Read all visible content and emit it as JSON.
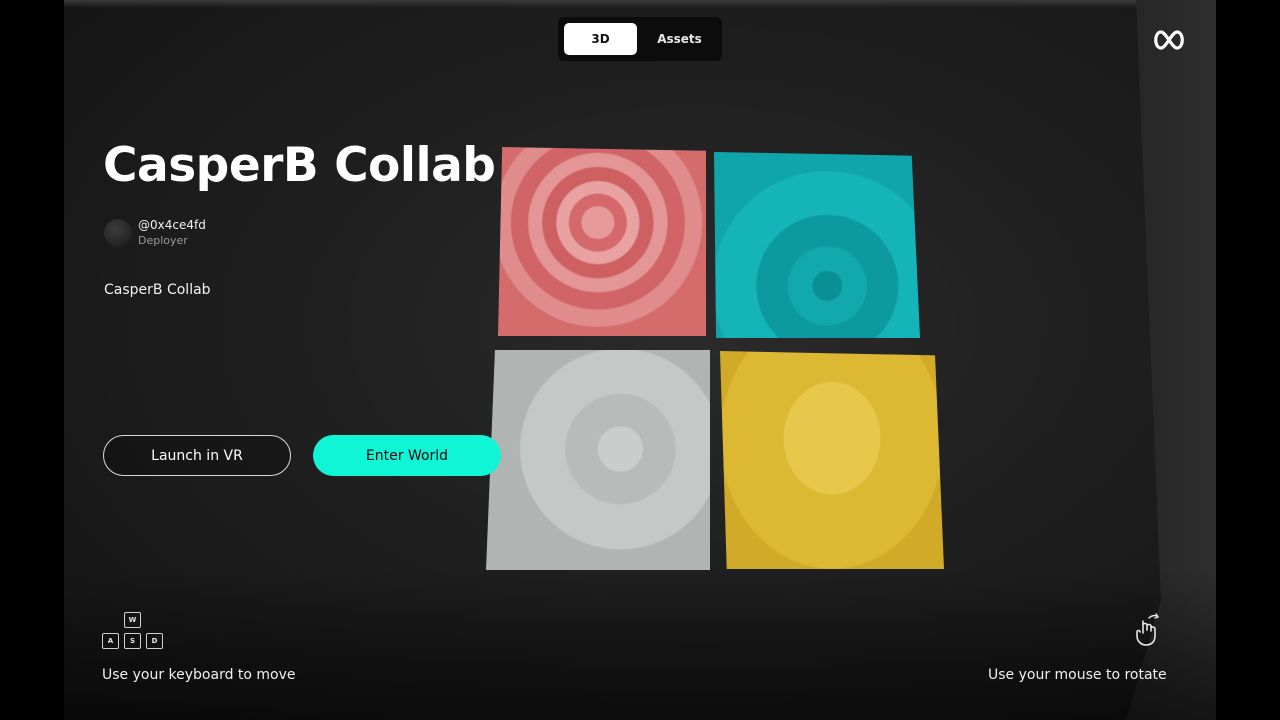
{
  "tabs": [
    {
      "label": "3D",
      "active": true
    },
    {
      "label": "Assets",
      "active": false
    }
  ],
  "logo_icon": "infinity-icon",
  "world": {
    "title": "CasperB Collab",
    "author_handle": "@0x4ce4fd",
    "author_role": "Deployer",
    "description": "CasperB Collab"
  },
  "actions": {
    "launch_vr": "Launch in VR",
    "enter_world": "Enter World"
  },
  "controls": {
    "keys": [
      "W",
      "A",
      "S",
      "D"
    ],
    "keyboard_hint": "Use your keyboard to move",
    "mouse_hint": "Use your mouse to rotate",
    "mouse_icon": "mouse-hand-icon"
  },
  "colors": {
    "accent": "#10f5d6",
    "background": "#1f1f1f"
  },
  "artworks": [
    {
      "color": "red",
      "motif": "rose"
    },
    {
      "color": "teal",
      "motif": "pattern"
    },
    {
      "color": "grey",
      "motif": "pattern"
    },
    {
      "color": "yellow",
      "motif": "texture"
    }
  ]
}
